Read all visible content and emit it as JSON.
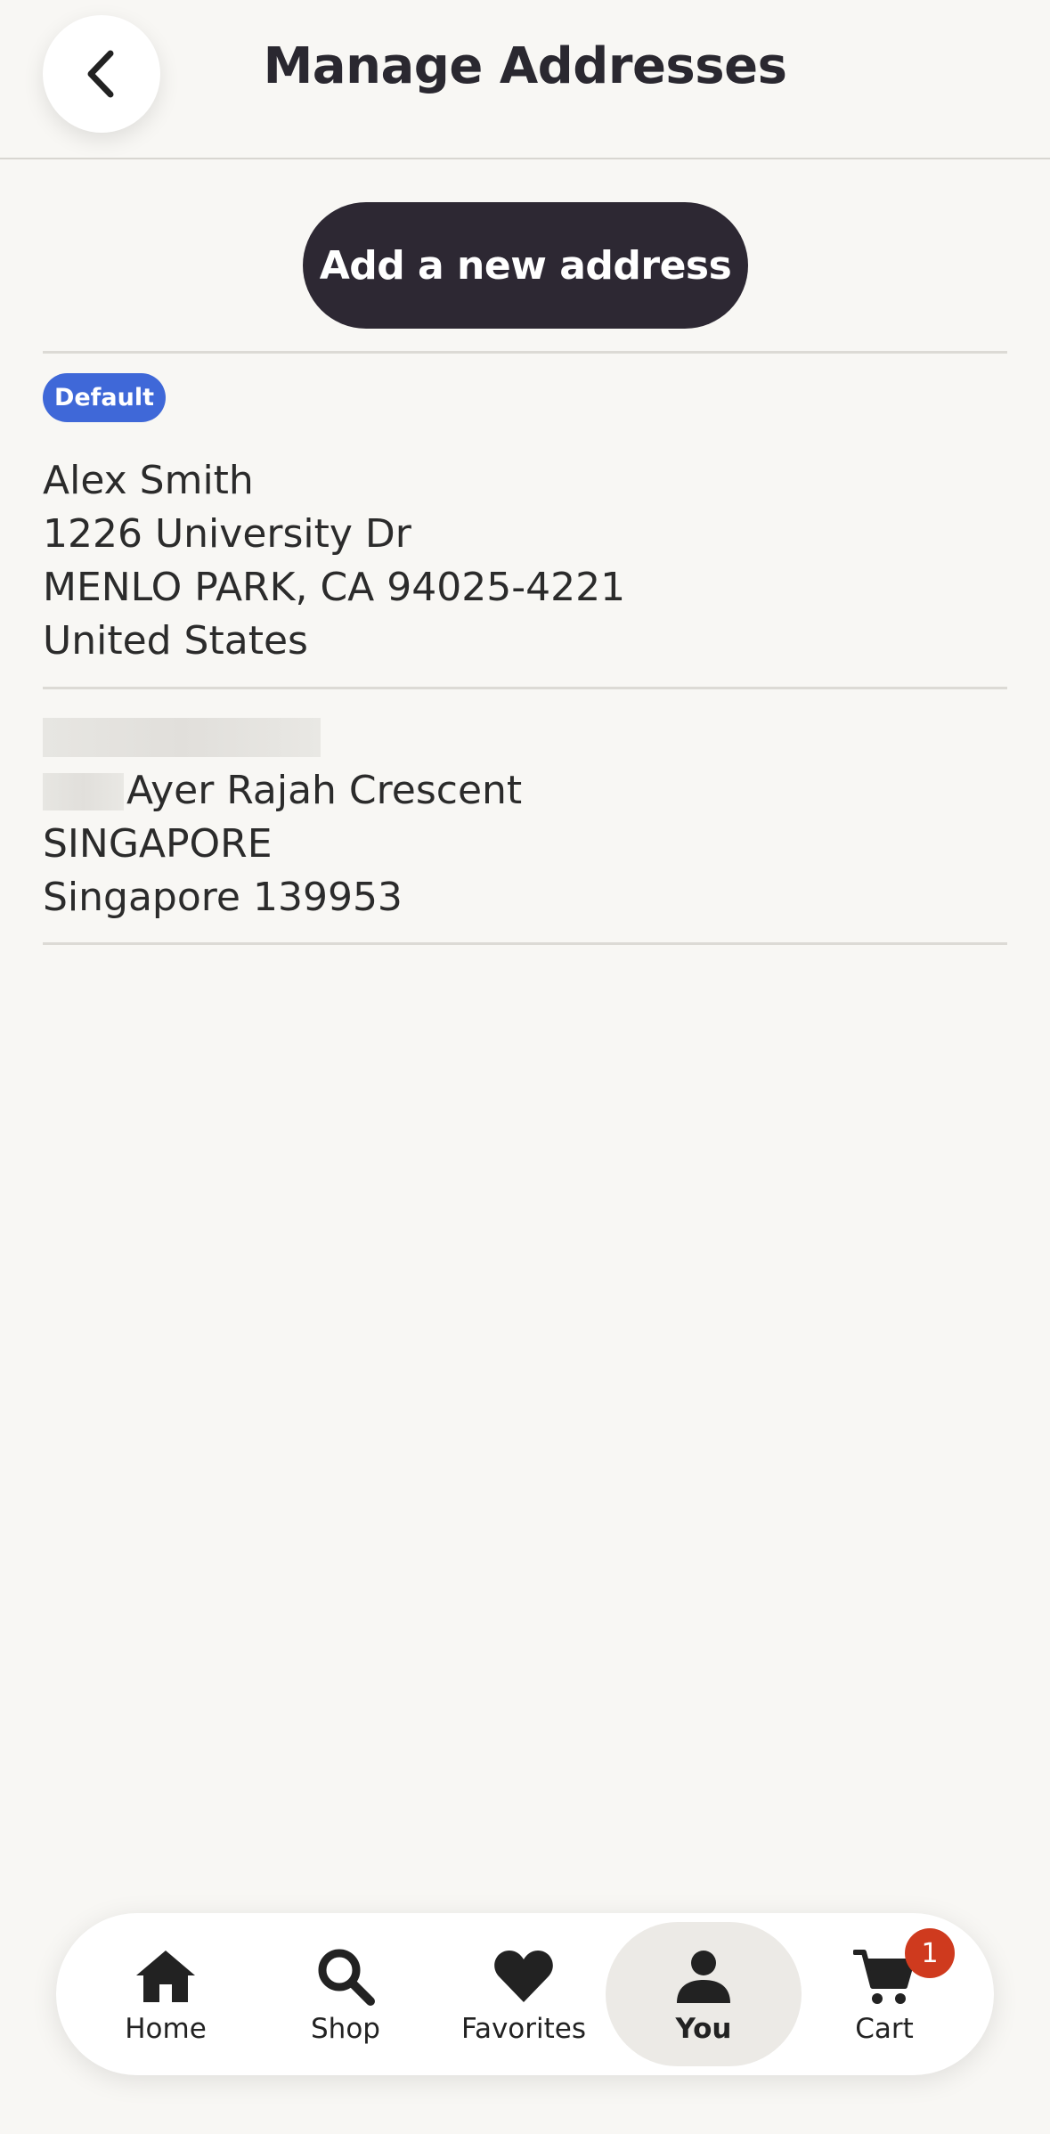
{
  "header": {
    "title": "Manage Addresses",
    "back_icon": "chevron-left-icon"
  },
  "actions": {
    "add_address_label": "Add a new address"
  },
  "addresses": [
    {
      "badge": "Default",
      "name": "Alex Smith",
      "line1": "1226 University Dr",
      "line2": "MENLO PARK, CA 94025-4221",
      "line3": "United States"
    },
    {
      "name": "",
      "line1": "Ayer Rajah Crescent",
      "line2": "SINGAPORE",
      "line3": "Singapore 139953"
    }
  ],
  "tabbar": {
    "items": [
      {
        "label": "Home",
        "icon": "home-icon"
      },
      {
        "label": "Shop",
        "icon": "search-icon"
      },
      {
        "label": "Favorites",
        "icon": "heart-icon"
      },
      {
        "label": "You",
        "icon": "person-icon",
        "active": true
      },
      {
        "label": "Cart",
        "icon": "cart-icon",
        "badge": "1"
      }
    ]
  },
  "colors": {
    "background": "#f8f7f4",
    "primary_button": "#2d2833",
    "default_badge": "#3f68d8",
    "cart_badge": "#cf3a1e"
  }
}
